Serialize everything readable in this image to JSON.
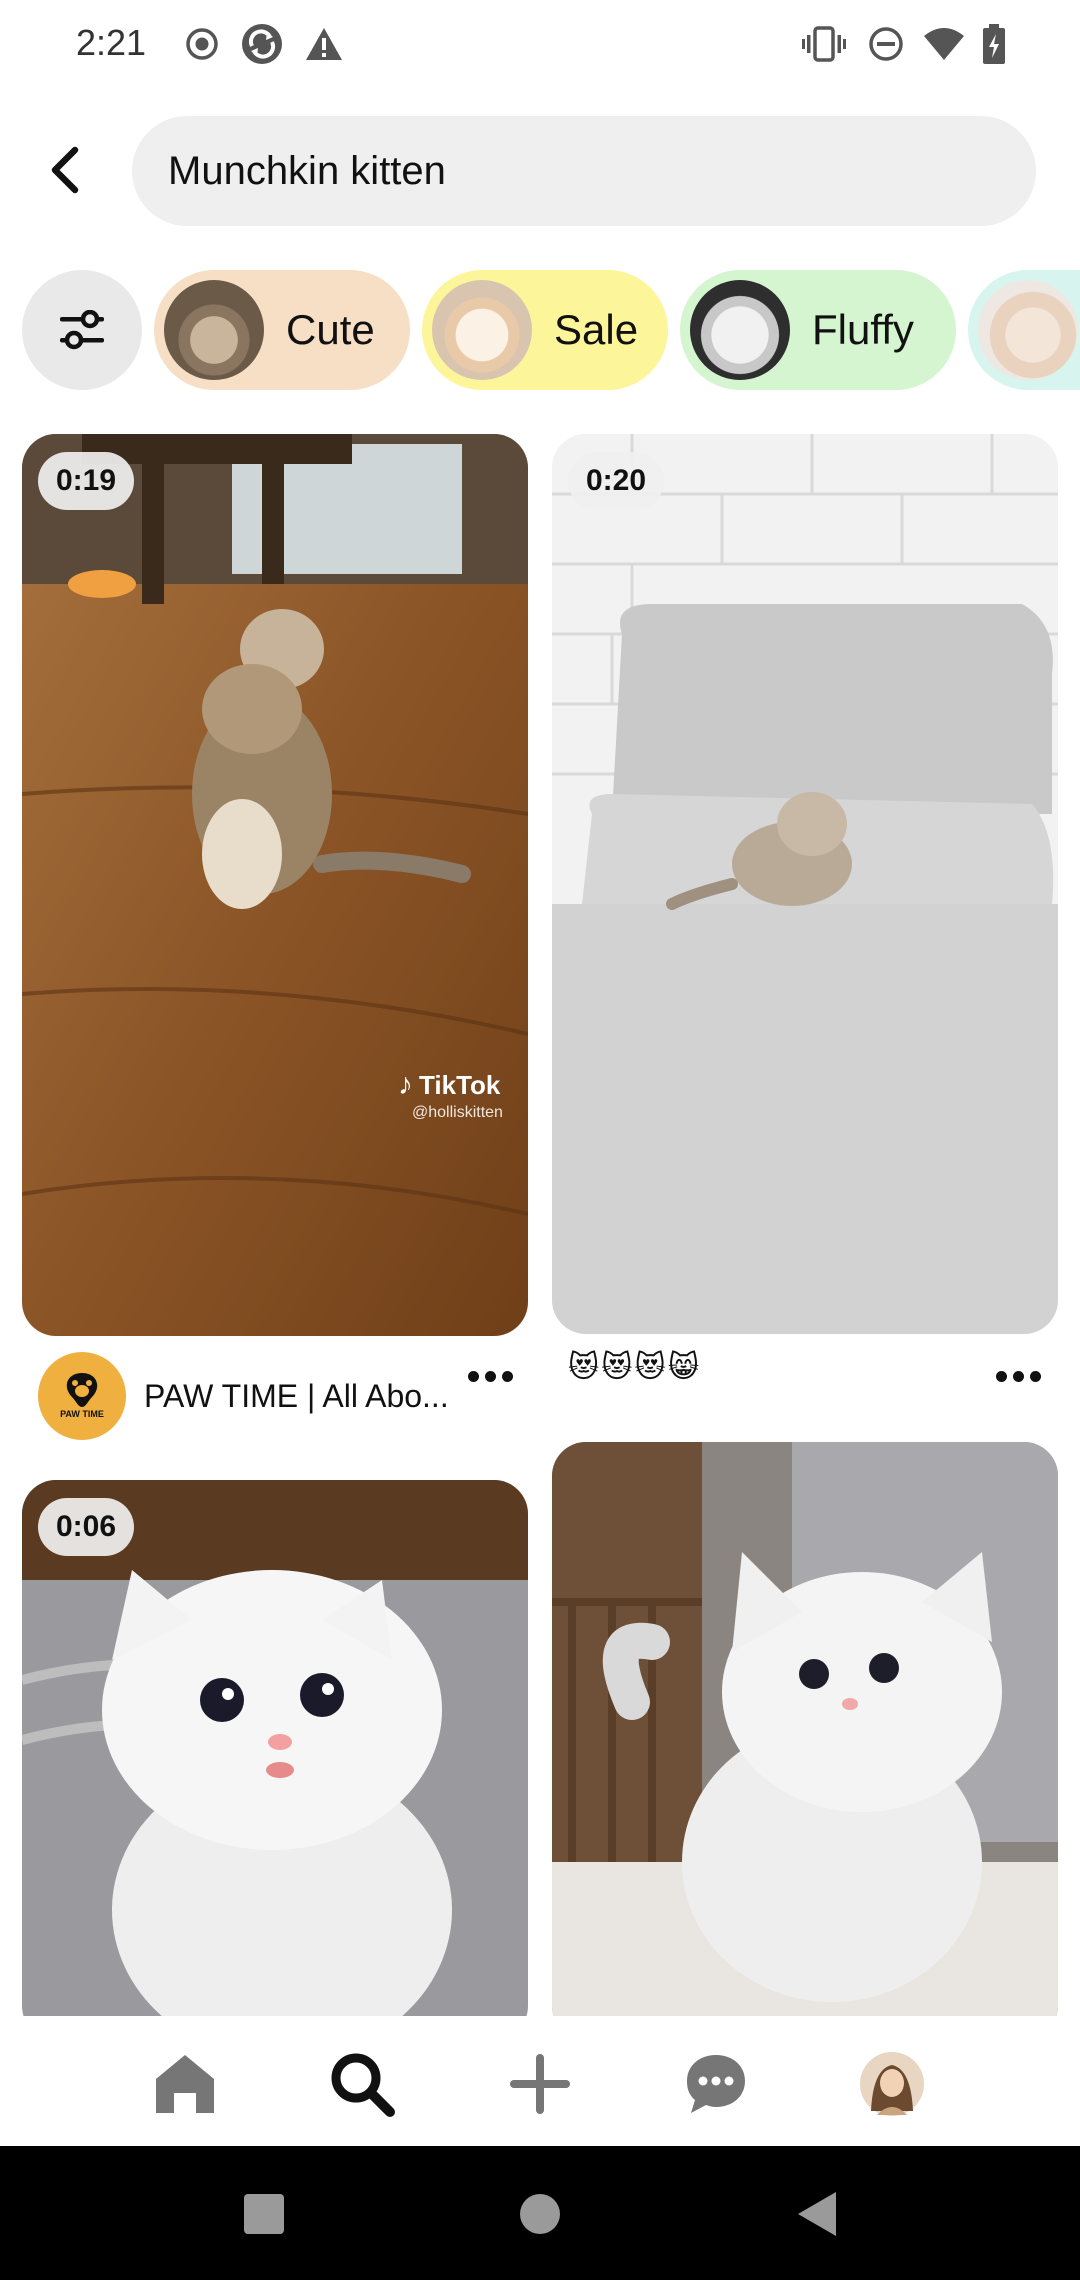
{
  "status_bar": {
    "time": "2:21",
    "icons_left": [
      "record-icon",
      "sync-icon",
      "warning-icon"
    ],
    "icons_right": [
      "vibrate-icon",
      "do-not-disturb-icon",
      "wifi-icon",
      "battery-charging-icon"
    ]
  },
  "search": {
    "query": "Munchkin kitten",
    "back_icon": "back-arrow-icon"
  },
  "filters": {
    "filter_icon": "sliders-icon",
    "chips": [
      {
        "label": "Cute",
        "color": "#f6dfc5"
      },
      {
        "label": "Sale",
        "color": "#fdf59a"
      },
      {
        "label": "Fluffy",
        "color": "#d4f5cf"
      },
      {
        "label": "",
        "color": "#d7f4ee"
      }
    ]
  },
  "feed": {
    "pins": [
      {
        "duration": "0:19",
        "author": "PAW TIME | All Abo...",
        "avatar_text": "PAW TIME",
        "watermark": "TikTok",
        "watermark_handle": "@holliskitten"
      },
      {
        "duration": "0:20",
        "caption": "😻😻😻😸"
      },
      {
        "duration": "0:06"
      },
      {}
    ]
  },
  "bottom_nav": {
    "items": [
      "home-icon",
      "search-icon",
      "create-icon",
      "messages-icon",
      "profile-avatar"
    ]
  },
  "system_nav": {
    "items": [
      "recents-button",
      "home-button",
      "back-button"
    ]
  },
  "colors": {
    "search_bg": "#efefef",
    "filter_bg": "#e9e9e9",
    "avatar_bg": "#f0b040"
  }
}
